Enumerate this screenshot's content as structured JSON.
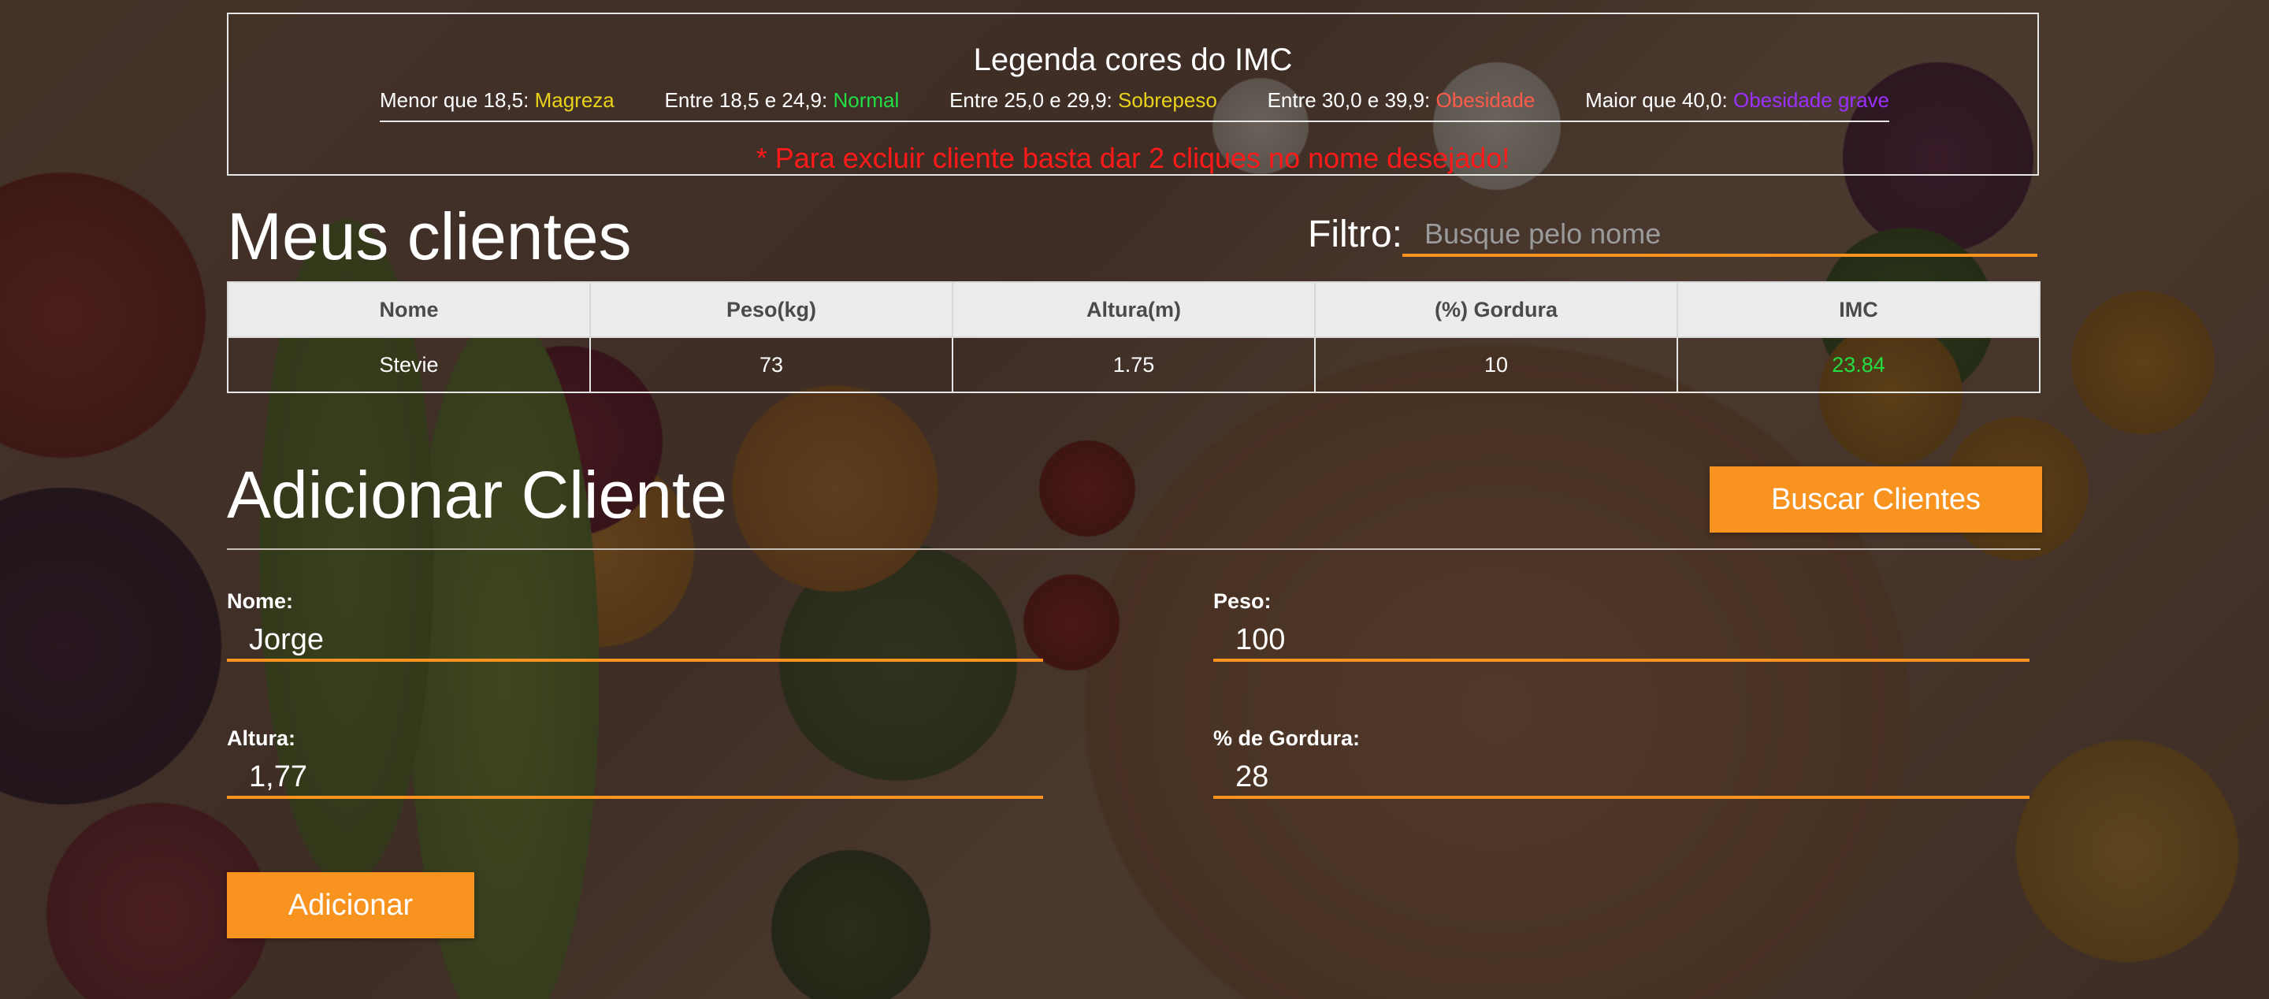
{
  "legend": {
    "title": "Legenda cores do IMC",
    "items": [
      {
        "label": "Menor que 18,5:",
        "value": "Magreza",
        "color": "#e8d21a"
      },
      {
        "label": "Entre 18,5 e 24,9:",
        "value": "Normal",
        "color": "#22dd44"
      },
      {
        "label": "Entre 25,0 e 29,9:",
        "value": "Sobrepeso",
        "color": "#e8d21a"
      },
      {
        "label": "Entre 30,0 e 39,9:",
        "value": "Obesidade",
        "color": "#ff5a4a"
      },
      {
        "label": "Maior que 40,0:",
        "value": "Obesidade grave",
        "color": "#9b30ff"
      }
    ],
    "note": "* Para excluir cliente basta dar 2 cliques no nome desejado!"
  },
  "clients_section": {
    "title": "Meus clientes",
    "filter_label": "Filtro:",
    "filter_placeholder": "Busque pelo nome",
    "filter_value": ""
  },
  "table": {
    "headers": [
      "Nome",
      "Peso(kg)",
      "Altura(m)",
      "(%) Gordura",
      "IMC"
    ],
    "rows": [
      {
        "nome": "Stevie",
        "peso": "73",
        "altura": "1.75",
        "gordura": "10",
        "imc": "23.84"
      }
    ]
  },
  "add_section": {
    "title": "Adicionar Cliente",
    "search_button": "Buscar Clientes",
    "fields": {
      "nome": {
        "label": "Nome:",
        "value": "Jorge"
      },
      "peso": {
        "label": "Peso:",
        "value": "100"
      },
      "altura": {
        "label": "Altura:",
        "value": "1,77"
      },
      "gordura": {
        "label": "% de Gordura:",
        "value": "28"
      }
    },
    "submit_button": "Adicionar"
  },
  "colors": {
    "accent": "#f7931e",
    "error": "#ff1a1a",
    "imc_normal": "#22dd44"
  }
}
